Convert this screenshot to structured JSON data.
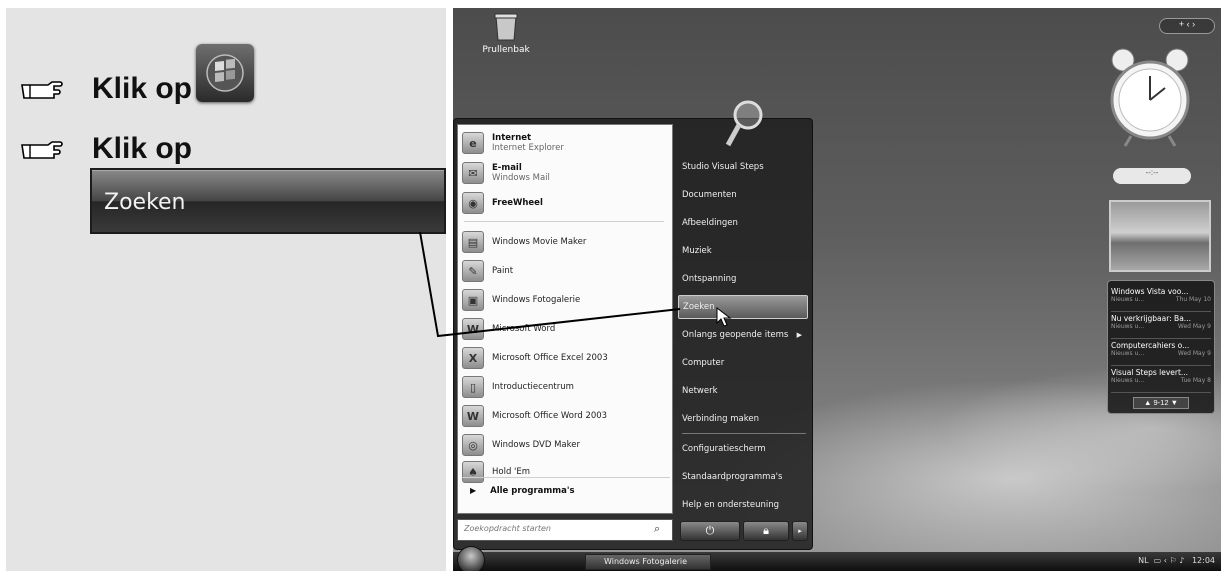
{
  "instructions": {
    "step1_text": "Klik op",
    "step2_text": "Klik op",
    "callout_label": "Zoeken"
  },
  "desktop": {
    "recycle_bin_label": "Prullenbak"
  },
  "start_menu": {
    "pinned": [
      {
        "title": "Internet",
        "subtitle": "Internet Explorer",
        "icon": "e"
      },
      {
        "title": "E-mail",
        "subtitle": "Windows Mail",
        "icon": "✉"
      }
    ],
    "recent": [
      {
        "label": "FreeWheel",
        "icon": "◉",
        "bold": true
      },
      {
        "label": "Windows Movie Maker",
        "icon": "▤"
      },
      {
        "label": "Paint",
        "icon": "✎"
      },
      {
        "label": "Windows Fotogalerie",
        "icon": "▣"
      },
      {
        "label": "Microsoft Word",
        "icon": "W"
      },
      {
        "label": "Microsoft Office Excel 2003",
        "icon": "X"
      },
      {
        "label": "Introductiecentrum",
        "icon": "▯"
      },
      {
        "label": "Microsoft Office Word 2003",
        "icon": "W"
      },
      {
        "label": "Windows DVD Maker",
        "icon": "◎"
      },
      {
        "label": "Hold 'Em",
        "icon": "♠"
      }
    ],
    "all_programs": "Alle programma's",
    "search_placeholder": "Zoekopdracht starten",
    "right_items": [
      "Studio Visual Steps",
      "Documenten",
      "Afbeeldingen",
      "Muziek",
      "Ontspanning",
      "Zoeken",
      "Onlangs geopende items",
      "Computer",
      "Netwerk",
      "Verbinding maken",
      "Configuratiescherm",
      "Standaardprogramma's",
      "Help en ondersteuning"
    ]
  },
  "taskbar": {
    "task_label": "Windows Fotogalerie",
    "tray_language": "NL",
    "tray_time": "12:04"
  },
  "gadgets": {
    "feeds": [
      {
        "title": "Windows Vista voo...",
        "date": "Thu May 10"
      },
      {
        "title": "Nu verkrijgbaar: Ba...",
        "date": "Wed May 9"
      },
      {
        "title": "Computercahiers o...",
        "date": "Wed May 9"
      },
      {
        "title": "Visual Steps levert...",
        "date": "Tue May 8"
      }
    ],
    "feed_source": "Nieuws u...",
    "feed_pager": "9-12",
    "cpu_text": "--:--"
  }
}
